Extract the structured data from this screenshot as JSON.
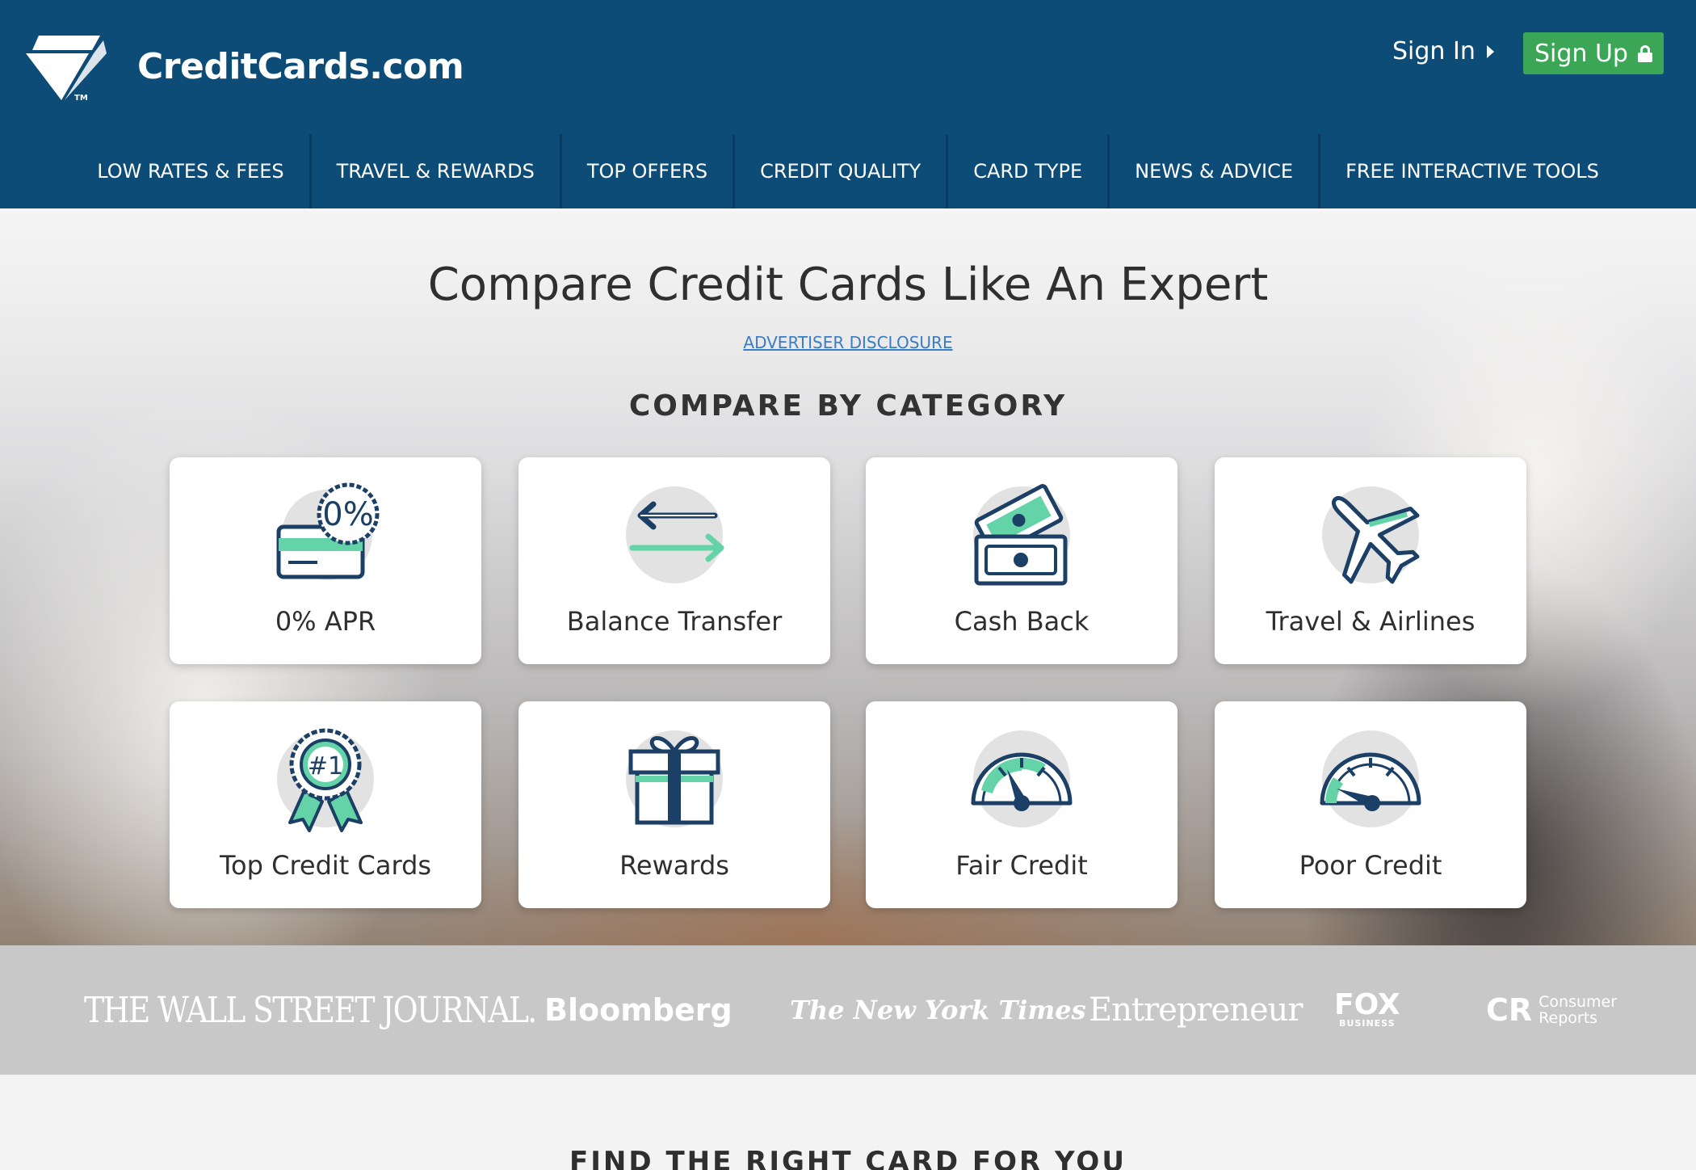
{
  "header": {
    "brand": "CreditCards.com",
    "trademark": "TM",
    "sign_in": "Sign In",
    "sign_up": "Sign Up"
  },
  "nav": [
    {
      "label": "LOW RATES & FEES"
    },
    {
      "label": "TRAVEL & REWARDS"
    },
    {
      "label": "TOP OFFERS"
    },
    {
      "label": "CREDIT QUALITY"
    },
    {
      "label": "CARD TYPE"
    },
    {
      "label": "NEWS & ADVICE"
    },
    {
      "label": "FREE INTERACTIVE TOOLS"
    }
  ],
  "hero": {
    "title": "Compare Credit Cards Like An Expert",
    "disclosure": "ADVERTISER DISCLOSURE",
    "category_title": "COMPARE BY CATEGORY"
  },
  "categories": [
    {
      "label": "0% APR",
      "icon": "zero-percent-card-icon",
      "badge": "0%"
    },
    {
      "label": "Balance Transfer",
      "icon": "transfer-arrows-icon"
    },
    {
      "label": "Cash Back",
      "icon": "cash-icon"
    },
    {
      "label": "Travel & Airlines",
      "icon": "airplane-icon"
    },
    {
      "label": "Top Credit Cards",
      "icon": "award-ribbon-icon",
      "badge": "#1"
    },
    {
      "label": "Rewards",
      "icon": "gift-icon"
    },
    {
      "label": "Fair Credit",
      "icon": "gauge-fair-icon"
    },
    {
      "label": "Poor Credit",
      "icon": "gauge-poor-icon"
    }
  ],
  "press": {
    "wsj": "THE WALL STREET JOURNAL.",
    "bloomberg": "Bloomberg",
    "nyt": "The New York Times",
    "entrepreneur": "Entrepreneur",
    "fox": "FOX",
    "fox_sub": "BUSINESS",
    "cr": "CR",
    "cr_sub1": "Consumer",
    "cr_sub2": "Reports"
  },
  "section": {
    "find_title": "FIND THE RIGHT CARD FOR YOU"
  },
  "colors": {
    "header_bg": "#0e4c78",
    "signup_green": "#3aa656",
    "icon_navy": "#1c3f66",
    "icon_mint": "#64d3a8",
    "press_bg": "#c8c8c8"
  }
}
